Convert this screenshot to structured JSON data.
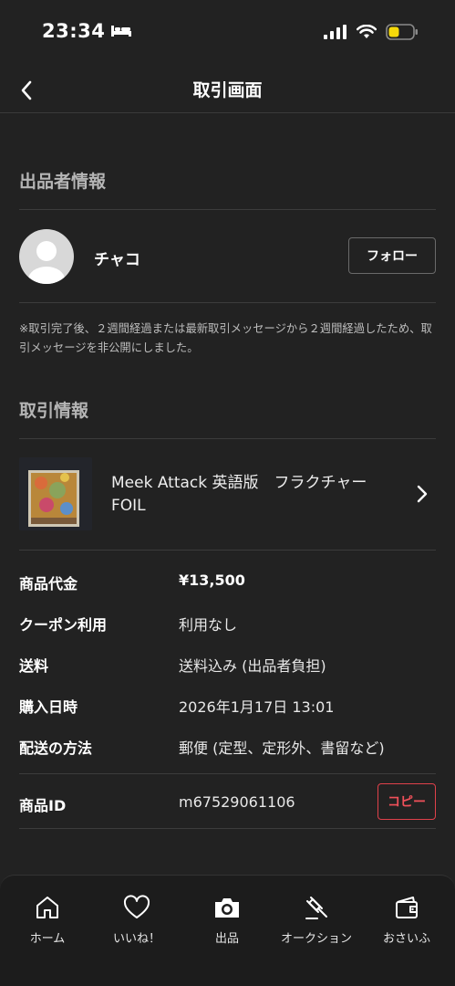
{
  "status_bar": {
    "time": "23:34"
  },
  "nav": {
    "title": "取引画面"
  },
  "seller_section": {
    "title": "出品者情報",
    "name": "チャコ",
    "follow_label": "フォロー",
    "notice": "※取引完了後、２週間経過または最新取引メッセージから２週間経過したため、取引メッセージを非公開にしました。"
  },
  "transaction_section": {
    "title": "取引情報",
    "item_title": "Meek Attack 英語版　フラクチャーFOIL",
    "rows": [
      {
        "label": "商品代金",
        "value": "¥13,500"
      },
      {
        "label": "クーポン利用",
        "value": "利用なし"
      },
      {
        "label": "送料",
        "value": "送料込み (出品者負担)"
      },
      {
        "label": "購入日時",
        "value": "2026年1月17日 13:01"
      },
      {
        "label": "配送の方法",
        "value": "郵便 (定型、定形外、書留など)"
      }
    ],
    "item_id_label": "商品ID",
    "item_id": "m67529061106",
    "copy_label": "コピー"
  },
  "tab_bar": {
    "tabs": [
      {
        "label": "ホーム",
        "icon": "home-icon"
      },
      {
        "label": "いいね！",
        "icon": "heart-icon"
      },
      {
        "label": "出品",
        "icon": "camera-icon"
      },
      {
        "label": "オークション",
        "icon": "gavel-icon"
      },
      {
        "label": "おさいふ",
        "icon": "wallet-icon"
      }
    ]
  }
}
